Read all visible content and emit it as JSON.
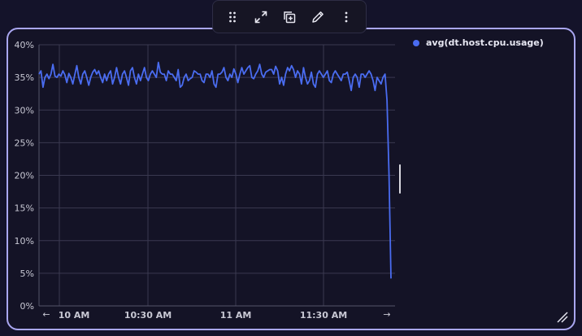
{
  "toolbar": {
    "icons": [
      "drag-handle-icon",
      "expand-icon",
      "duplicate-icon",
      "edit-icon",
      "more-icon"
    ]
  },
  "legend": {
    "series_label": "avg(dt.host.cpu.usage)"
  },
  "navigation": {
    "prev_arrow": "←",
    "next_arrow": "→"
  },
  "chart_data": {
    "type": "line",
    "ylim": [
      0,
      40
    ],
    "y_ticks": [
      "40%",
      "35%",
      "30%",
      "25%",
      "20%",
      "15%",
      "10%",
      "5%",
      "0%"
    ],
    "x_ticks": [
      "10 AM",
      "10:30 AM",
      "11 AM",
      "11:30 AM"
    ],
    "grid": true,
    "legend_position": "right",
    "series": [
      {
        "name": "avg(dt.host.cpu.usage)",
        "color": "#4a6cf0",
        "values": [
          35.5,
          36.0,
          33.5,
          35.0,
          35.5,
          34.8,
          35.5,
          37.0,
          35.2,
          35.0,
          35.5,
          35.2,
          36.0,
          35.4,
          34.2,
          35.6,
          35.0,
          34.0,
          35.4,
          36.8,
          35.0,
          34.0,
          35.5,
          36.0,
          35.0,
          33.8,
          35.0,
          35.8,
          36.2,
          35.5,
          36.0,
          35.0,
          34.2,
          35.5,
          34.5,
          35.5,
          36.0,
          34.0,
          35.0,
          36.5,
          35.0,
          34.0,
          35.5,
          36.0,
          35.0,
          33.8,
          36.0,
          36.5,
          35.0,
          34.0,
          35.5,
          34.5,
          35.5,
          36.5,
          35.0,
          34.5,
          35.5,
          36.0,
          35.5,
          35.0,
          37.3,
          35.8,
          35.5,
          35.5,
          34.5,
          36.0,
          35.5,
          35.5,
          35.0,
          34.5,
          36.2,
          33.5,
          33.8,
          35.0,
          35.5,
          34.5,
          34.8,
          35.0,
          36.0,
          35.8,
          35.5,
          35.5,
          34.5,
          34.2,
          35.5,
          35.5,
          35.0,
          36.0,
          34.0,
          33.5,
          35.5,
          35.5,
          35.8,
          36.5,
          35.0,
          34.5,
          35.5,
          35.0,
          36.3,
          35.5,
          34.2,
          35.5,
          36.5,
          35.5,
          36.0,
          36.5,
          36.8,
          35.0,
          34.8,
          35.5,
          36.0,
          37.0,
          35.5,
          35.0,
          35.8,
          36.0,
          36.2,
          36.2,
          35.5,
          36.7,
          36.0,
          34.0,
          35.0,
          33.8,
          35.5,
          36.5,
          36.0,
          36.8,
          36.2,
          35.0,
          36.0,
          35.5,
          34.0,
          36.5,
          35.0,
          34.0,
          34.5,
          35.8,
          34.0,
          33.5,
          35.5,
          36.0,
          35.5,
          35.0,
          35.5,
          36.0,
          34.5,
          34.2,
          35.5,
          36.0,
          35.5,
          35.0,
          34.5,
          35.5,
          35.5,
          35.8,
          34.5,
          33.0,
          35.0,
          35.5,
          35.0,
          33.5,
          35.5,
          35.5,
          35.0,
          35.5,
          36.0,
          35.5,
          34.5,
          33.0,
          35.0,
          34.5,
          34.0,
          35.0,
          35.5,
          31.5,
          20.0,
          4.2
        ]
      }
    ]
  }
}
